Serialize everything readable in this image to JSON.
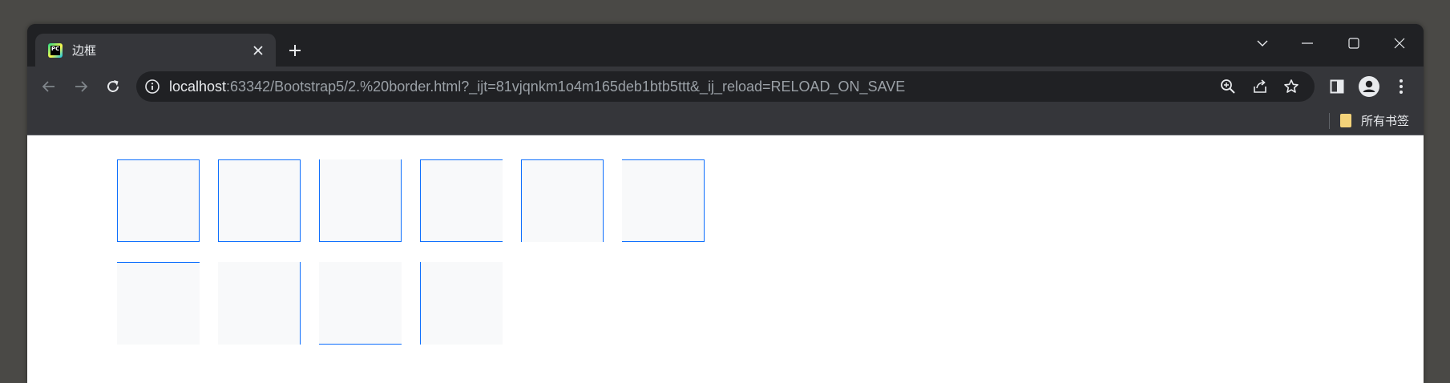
{
  "tab": {
    "title": "边框",
    "favicon": "pycharm-icon"
  },
  "address_bar": {
    "host": "localhost",
    "path": ":63342/Bootstrap5/2.%20border.html?_ijt=81vjqnkm1o4m165deb1btb5ttt&_ij_reload=RELOAD_ON_SAVE"
  },
  "bookmarks_bar": {
    "all_bookmarks_label": "所有书签"
  },
  "page": {
    "border_color": "#0d6efd",
    "box_background": "#f8f9fa",
    "rows": [
      {
        "boxes": [
          {
            "borders": "all"
          },
          {
            "borders": "all"
          },
          {
            "borders": "right-bottom-left"
          },
          {
            "borders": "top-bottom-left"
          },
          {
            "borders": "top-right-left"
          },
          {
            "borders": "top-right-bottom"
          }
        ]
      },
      {
        "boxes": [
          {
            "borders": "top"
          },
          {
            "borders": "right"
          },
          {
            "borders": "bottom"
          },
          {
            "borders": "left"
          }
        ]
      }
    ]
  }
}
